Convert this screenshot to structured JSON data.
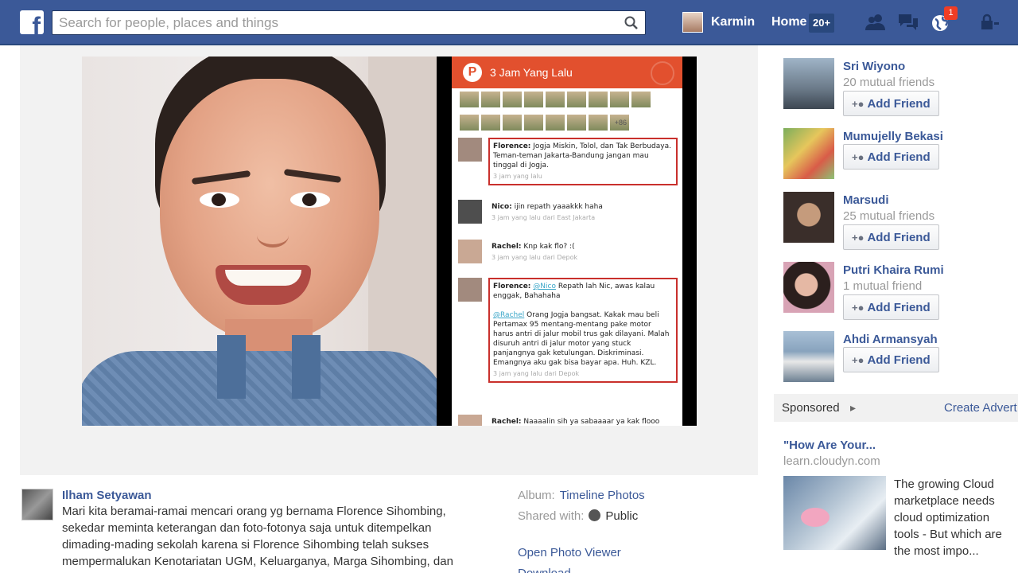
{
  "header": {
    "search_placeholder": "Search for people, places and things",
    "user_name": "Karmin",
    "home_label": "Home",
    "home_count": "20+",
    "notification_count": "1",
    "brand_color": "#3b5998"
  },
  "photo": {
    "phone_title": "3 Jam Yang Lalu",
    "emoji_more": "+86",
    "messages": [
      {
        "author": "Florence:",
        "text": "Jogja Miskin, Tolol, dan Tak Berbudaya. Teman-teman Jakarta-Bandung jangan mau tinggal di Jogja.",
        "meta": "3 jam yang lalu"
      },
      {
        "author": "Nico:",
        "text": "ijin repath yaaakkk haha",
        "meta": "3 jam yang lalu dari East Jakarta"
      },
      {
        "author": "Rachel:",
        "text": "Knp kak flo? :(",
        "meta": "3 jam yang lalu dari Depok"
      },
      {
        "author": "Florence:",
        "mention1": "@Nico",
        "text1": "Repath lah Nic, awas kalau enggak, Bahahaha",
        "mention2": "@Rachel",
        "text2": "Orang Jogja bangsat. Kakak mau beli Pertamax 95 mentang-mentang pake motor harus antri di jalur mobil trus gak dilayani. Malah disuruh antri di jalur motor yang stuck panjangnya gak ketulungan. Diskriminasi. Emangnya aku gak bisa bayar apa. Huh. KZL.",
        "meta": "3 jam yang lalu dari Depok"
      },
      {
        "author": "Rachel:",
        "text": "Naaaalin sih ya sabaaaar ya kak flooo",
        "meta": ""
      }
    ]
  },
  "caption": {
    "author": "Ilham Setyawan",
    "text": "Mari kita beramai-ramai mencari orang yg bernama Florence Sihombing, sekedar meminta keterangan dan foto-fotonya saja untuk ditempelkan dimading-mading sekolah karena si Florence Sihombing telah sukses mempermalukan Kenotariatan UGM, Keluarganya, Marga Sihombing, dan semua teman-temannya, si Florence Sihombing telah sukses pula"
  },
  "photo_meta": {
    "album_label": "Album:",
    "album_value": "Timeline Photos",
    "shared_label": "Shared with:",
    "shared_value": "Public",
    "open_viewer": "Open Photo Viewer",
    "download": "Download"
  },
  "pymk": [
    {
      "name": "Sri Wiyono",
      "mutual": "20 mutual friends",
      "button": "Add Friend"
    },
    {
      "name": "Mumujelly Bekasi",
      "mutual": "",
      "button": "Add Friend"
    },
    {
      "name": "Marsudi",
      "mutual": "25 mutual friends",
      "button": "Add Friend"
    },
    {
      "name": "Putri Khaira Rumi",
      "mutual": "1 mutual friend",
      "button": "Add Friend"
    },
    {
      "name": "Ahdi Armansyah",
      "mutual": "",
      "button": "Add Friend"
    }
  ],
  "sponsored": {
    "label": "Sponsored",
    "create_ad": "Create Advert",
    "ad_title": "\"How Are Your...",
    "ad_url": "learn.cloudyn.com",
    "ad_body": "The growing Cloud marketplace needs cloud optimization tools - But which are the most impo..."
  }
}
